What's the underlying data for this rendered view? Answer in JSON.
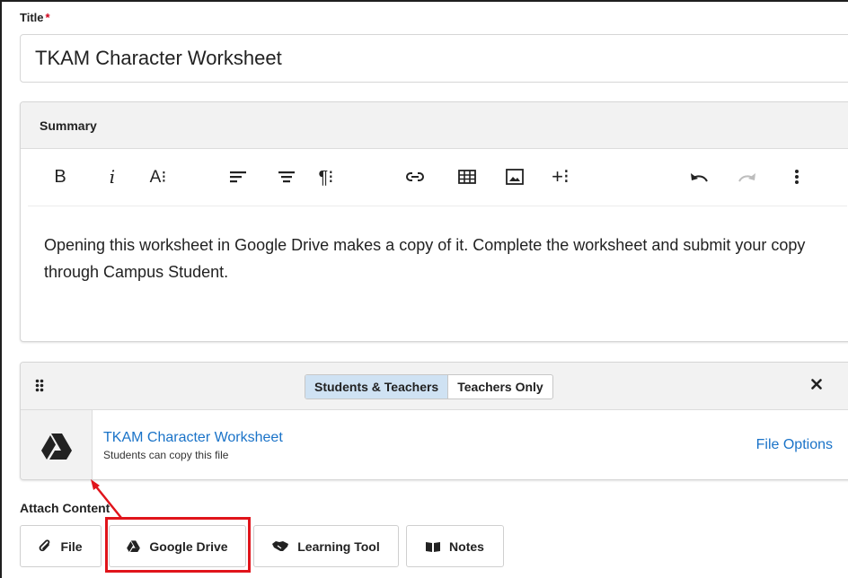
{
  "form": {
    "title_label": "Title",
    "required_mark": "*",
    "title_value": "TKAM Character Worksheet"
  },
  "summary": {
    "header": "Summary",
    "toolbar": {
      "bold": "B",
      "italic": "i",
      "font_size": "A⁝",
      "paragraph": "¶⁝",
      "insert": "+⁝"
    },
    "body_text": "Opening this worksheet in Google Drive makes a copy of it. Complete the worksheet and submit your copy through Campus Student."
  },
  "attachment": {
    "visibility_options": [
      "Students & Teachers",
      "Teachers Only"
    ],
    "selected_visibility": "Students & Teachers",
    "file_name": "TKAM Character Worksheet",
    "file_note": "Students can copy this file",
    "file_options_label": "File Options"
  },
  "attach_content": {
    "label": "Attach Content",
    "buttons": [
      {
        "label": "File",
        "icon": "paperclip-icon"
      },
      {
        "label": "Google Drive",
        "icon": "google-drive-icon"
      },
      {
        "label": "Learning Tool",
        "icon": "handshake-icon"
      },
      {
        "label": "Notes",
        "icon": "book-icon"
      }
    ]
  },
  "annotation": {
    "highlight_color": "#e0141b",
    "highlighted_button": "Google Drive"
  },
  "colors": {
    "link": "#1a73c8",
    "required": "#d0021b",
    "segment_active": "#cfe2f3"
  }
}
